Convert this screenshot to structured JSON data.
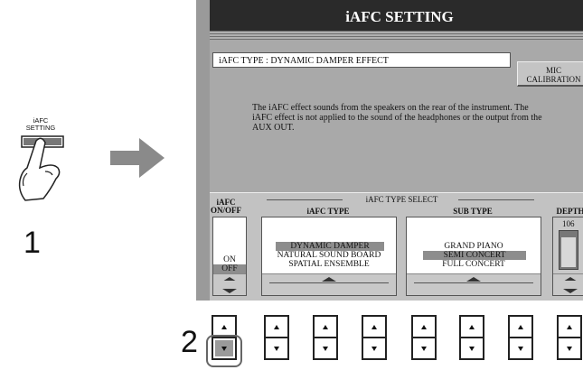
{
  "steps": {
    "step1": "1",
    "step2": "2"
  },
  "panel_button": {
    "line1": "iAFC",
    "line2": "SETTING"
  },
  "screen": {
    "title": "iAFC SETTING",
    "type_label": "iAFC TYPE : DYNAMIC DAMPER EFFECT",
    "mic_calibration": {
      "line1": "MIC",
      "line2": "CALIBRATION"
    },
    "description": "The iAFC effect sounds from the speakers on the rear of the instrument. The iAFC effect is not applied to the sound of the headphones or the output from the AUX OUT.",
    "type_select_title": "iAFC TYPE SELECT",
    "onoff": {
      "head1": "iAFC",
      "head2": "ON/OFF",
      "items": [
        "ON",
        "OFF"
      ],
      "selected": "OFF"
    },
    "iafc_type": {
      "head": "iAFC TYPE",
      "items": [
        "DYNAMIC DAMPER",
        "NATURAL SOUND BOARD",
        "SPATIAL ENSEMBLE"
      ],
      "selected": "DYNAMIC DAMPER"
    },
    "sub_type": {
      "head": "SUB TYPE",
      "items": [
        "GRAND PIANO",
        "SEMI CONCERT",
        "FULL CONCERT"
      ],
      "selected": "SEMI CONCERT"
    },
    "depth": {
      "head": "DEPTH",
      "value": "106",
      "level_fraction": 0.83
    }
  },
  "colors": {
    "title_bar": "#2a2a2a",
    "screen_bg": "#9a9a9a",
    "selection": "#8d8d8d",
    "arrow": "#8a8a8a"
  },
  "hardware_buttons": {
    "count": 8,
    "pressed_index": 0,
    "pressed_part": "down"
  }
}
